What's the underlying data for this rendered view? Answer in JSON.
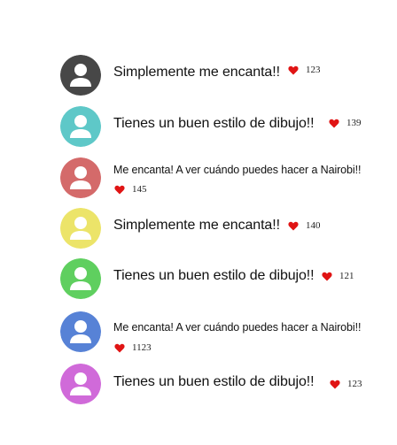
{
  "comments": [
    {
      "text": "Simplemente me encanta!!",
      "likes": "123",
      "avatar_color": "#474747"
    },
    {
      "text": "Tienes un buen estilo de dibujo!!",
      "likes": "139",
      "avatar_color": "#5ec8c8"
    },
    {
      "text": "Me encanta! A ver cuándo puedes hacer a Nairobi!!",
      "likes": "145",
      "avatar_color": "#d46a6a"
    },
    {
      "text": "Simplemente me encanta!!",
      "likes": "140",
      "avatar_color": "#ece469"
    },
    {
      "text": "Tienes un buen estilo de dibujo!!",
      "likes": "121",
      "avatar_color": "#5fcf5f"
    },
    {
      "text": "Me encanta! A ver cuándo puedes hacer a Nairobi!!",
      "likes": "1123",
      "avatar_color": "#5782d6"
    },
    {
      "text": "Tienes un buen estilo de dibujo!!",
      "likes": "123",
      "avatar_color": "#d06ad9"
    }
  ],
  "icons": {
    "avatar": "user-avatar-icon",
    "like": "heart-icon"
  },
  "colors": {
    "heart": "#e01414",
    "background": "#ffffff"
  }
}
